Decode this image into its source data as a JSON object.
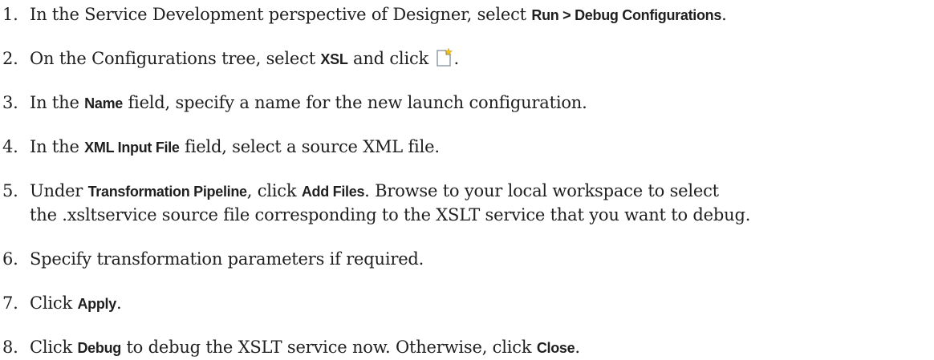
{
  "steps": [
    {
      "num": "1.",
      "t1": "In the Service Development perspective of Designer, select ",
      "b1": "Run > Debug Configurations",
      "t2": "."
    },
    {
      "num": "2.",
      "t1": "On the Configurations tree, select ",
      "b1": "XSL",
      "t2": " and click ",
      "icon": "new-launch-configuration-icon",
      "t3": "."
    },
    {
      "num": "3.",
      "t1": "In the ",
      "b1": "Name",
      "t2": " field, specify a name for the new launch configuration."
    },
    {
      "num": "4.",
      "t1": "In the ",
      "b1": "XML Input File",
      "t2": " field, select a source XML file."
    },
    {
      "num": "5.",
      "t1": "Under ",
      "b1": "Transformation Pipeline",
      "t2": ", click ",
      "b2": "Add Files",
      "t3": ". Browse to your local workspace to select",
      "line2": "the .xsltservice source file corresponding to the XSLT service that you want to debug."
    },
    {
      "num": "6.",
      "t1": "Specify transformation parameters if required."
    },
    {
      "num": "7.",
      "t1": "Click ",
      "b1": "Apply",
      "t2": "."
    },
    {
      "num": "8.",
      "t1": "Click ",
      "b1": "Debug",
      "t2": " to debug the XSLT service now. Otherwise, click ",
      "b2": "Close",
      "t3": "."
    }
  ]
}
